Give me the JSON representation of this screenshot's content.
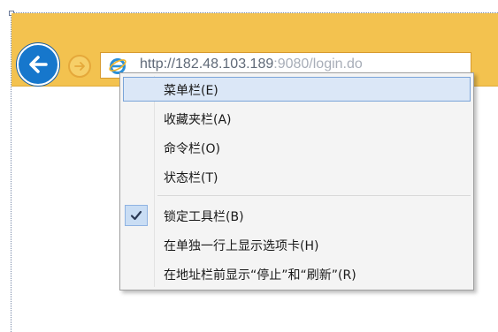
{
  "window": {
    "url_host": "http://182.48.103.189",
    "url_port": ":9080",
    "url_path": "/login.do"
  },
  "icons": {
    "back": "back-arrow-icon",
    "forward": "forward-arrow-icon",
    "page": "ie-page-icon",
    "check": "checkmark-icon"
  },
  "colors": {
    "toolbar": "#f3c24f",
    "back_button": "#1677cc",
    "menu_hover": "#dbe7f7"
  },
  "context_menu": {
    "items": [
      {
        "label": "菜单栏(E)",
        "highlighted": true,
        "checked": false
      },
      {
        "label": "收藏夹栏(A)",
        "highlighted": false,
        "checked": false
      },
      {
        "label": "命令栏(O)",
        "highlighted": false,
        "checked": false
      },
      {
        "label": "状态栏(T)",
        "highlighted": false,
        "checked": false
      },
      {
        "label": "锁定工具栏(B)",
        "highlighted": false,
        "checked": true
      },
      {
        "label": "在单独一行上显示选项卡(H)",
        "highlighted": false,
        "checked": false
      },
      {
        "label": "在地址栏前显示“停止”和“刷新”(R)",
        "highlighted": false,
        "checked": false
      }
    ]
  }
}
